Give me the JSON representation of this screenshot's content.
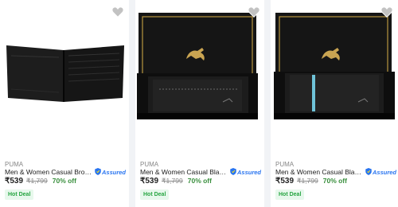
{
  "products": [
    {
      "brand": "PUMA",
      "title": "Men & Women Casual Brown Genuine Leather Wallet",
      "assured": "Assured",
      "price": "₹539",
      "mrp": "₹1,799",
      "discount": "70% off",
      "badge": "Hot Deal",
      "image": "wallet-open-icon"
    },
    {
      "brand": "PUMA",
      "title": "Men & Women Casual Black Genuine Leather Wallet",
      "assured": "Assured",
      "price": "₹539",
      "mrp": "₹1,799",
      "discount": "70% off",
      "badge": "Hot Deal",
      "image": "wallet-gift-box-icon"
    },
    {
      "brand": "PUMA",
      "title": "Men & Women Casual Black Genuine Leather Wallet",
      "assured": "Assured",
      "price": "₹539",
      "mrp": "₹1,799",
      "discount": "70% off",
      "badge": "Hot Deal",
      "image": "wallet-gift-box-blue-stripe-icon"
    }
  ],
  "colors": {
    "assured_blue": "#2874f0",
    "discount_green": "#388e3c",
    "deal_bg": "#e7f8ec",
    "box_gold": "#b8953f"
  }
}
